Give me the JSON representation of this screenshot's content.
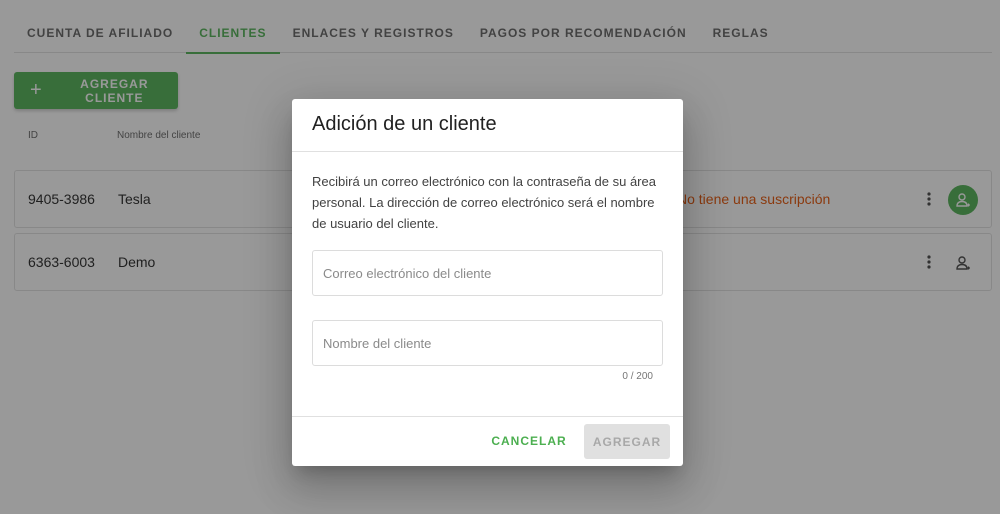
{
  "tabs": [
    {
      "label": "CUENTA DE AFILIADO"
    },
    {
      "label": "CLIENTES"
    },
    {
      "label": "ENLACES Y REGISTROS"
    },
    {
      "label": "PAGOS POR RECOMENDACIÓN"
    },
    {
      "label": "REGLAS"
    }
  ],
  "toolbar": {
    "add_client_label": "AGREGAR CLIENTE"
  },
  "table": {
    "headers": {
      "id": "ID",
      "name": "Nombre del cliente"
    },
    "rows": [
      {
        "id": "9405-3986",
        "name": "Tesla",
        "status": "No tiene una suscripción"
      },
      {
        "id": "6363-6003",
        "name": "Demo",
        "status": ""
      }
    ]
  },
  "dialog": {
    "title": "Adición de un cliente",
    "description": "Recibirá un correo electrónico con la contraseña de su área personal. La dirección de correo electrónico será el nombre de usuario del cliente.",
    "email_placeholder": "Correo electrónico del cliente",
    "email_value": "",
    "name_placeholder": "Nombre del cliente",
    "name_value": "",
    "counter": "0 / 200",
    "cancel_label": "CANCELAR",
    "add_label": "AGREGAR"
  },
  "colors": {
    "accent": "#4caf50",
    "warning": "#e65100"
  },
  "icons": {
    "add": "plus-icon",
    "more": "kebab-menu-icon",
    "user": "user-account-icon"
  }
}
